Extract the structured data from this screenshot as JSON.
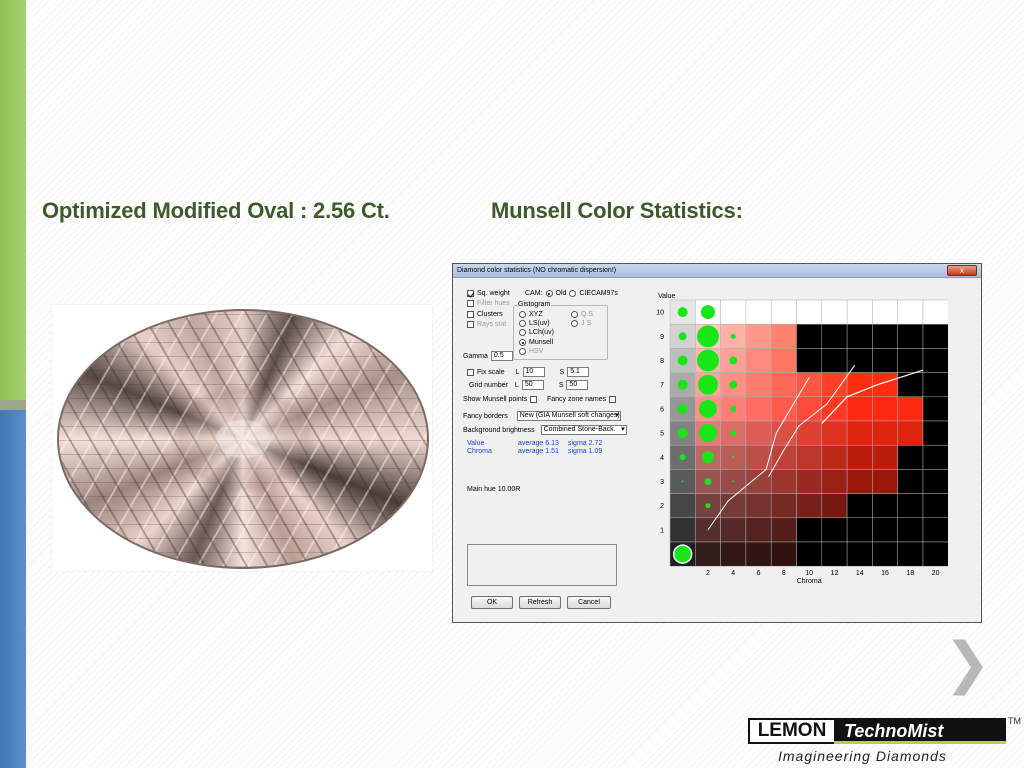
{
  "slide": {
    "title_left": "Optimized Modified Oval : 2.56 Ct.",
    "title_right": "Munsell Color Statistics:",
    "next_arrow": "❯",
    "colors": {
      "accent_green": "#8cc152",
      "accent_blue": "#3f78b8",
      "heading": "#3d5a2a"
    }
  },
  "dialog": {
    "title": "Diamond color statistics (NO chromatic dispersion!)",
    "close": "x",
    "sq_weight": "Sq. weight",
    "filter_hues": "Filter hues",
    "clusters": "Clusters",
    "rays_stat": "Rays stat",
    "cam_label": "CAM:",
    "cam_old": "Old",
    "cam_ciecam": "CIECAM97s",
    "gistogram": "Gistogram",
    "opt_xyz": "XYZ",
    "opt_ls": "LS(uv)",
    "opt_lch": "LCh(uv)",
    "opt_munsell": "Munsell",
    "opt_hsv": "HSV",
    "opt_qs": "Q S",
    "opt_js": "J S",
    "gamma_label": "Gamma",
    "gamma_value": "0.5",
    "fix_scale": "Fix scale",
    "l_label": "L",
    "s_label": "S",
    "fix_l": "10",
    "fix_s": "5.1",
    "grid_number": "Grid number",
    "grid_l": "50",
    "grid_s": "50",
    "show_munsell": "Show Munsell points",
    "fancy_zone": "Fancy zone names",
    "fancy_borders": "Fancy borders",
    "fancy_borders_value": "New (GIA Munsell soft changes)",
    "background_brightness": "Background brightness",
    "background_value": "Combined Stone-Back.",
    "stats": {
      "value_label": "Value",
      "value_avg": "average  6.13",
      "value_sigma": "sigma  2.72",
      "chroma_label": "Chroma",
      "chroma_avg": "average  1.51",
      "chroma_sigma": "sigma  1.09"
    },
    "main_hue": "Main hue 10.00R",
    "ok": "OK",
    "refresh": "Refresh",
    "cancel": "Cancel"
  },
  "chart_data": {
    "type": "heatmap",
    "title": "",
    "xlabel": "Chroma",
    "ylabel": "Value",
    "x_ticks": [
      2,
      4,
      6,
      8,
      10,
      12,
      14,
      16,
      18,
      20
    ],
    "y_ticks": [
      1,
      2,
      3,
      4,
      5,
      6,
      7,
      8,
      9,
      10
    ],
    "xlim": [
      0,
      20
    ],
    "ylim": [
      0,
      10
    ],
    "points": [
      {
        "x": 0,
        "y": 0,
        "size": 9
      },
      {
        "x": 0,
        "y": 3,
        "size": 1
      },
      {
        "x": 0,
        "y": 4,
        "size": 3
      },
      {
        "x": 0,
        "y": 5,
        "size": 5
      },
      {
        "x": 0,
        "y": 6,
        "size": 5
      },
      {
        "x": 0,
        "y": 7,
        "size": 5
      },
      {
        "x": 0,
        "y": 8,
        "size": 5
      },
      {
        "x": 0,
        "y": 9,
        "size": 4
      },
      {
        "x": 0,
        "y": 10,
        "size": 5
      },
      {
        "x": 2,
        "y": 1,
        "size": 0.6
      },
      {
        "x": 2,
        "y": 2,
        "size": 2.5
      },
      {
        "x": 2,
        "y": 3,
        "size": 3.5
      },
      {
        "x": 2,
        "y": 4,
        "size": 6
      },
      {
        "x": 2,
        "y": 5,
        "size": 9
      },
      {
        "x": 2,
        "y": 6,
        "size": 9
      },
      {
        "x": 2,
        "y": 7,
        "size": 10
      },
      {
        "x": 2,
        "y": 8,
        "size": 11
      },
      {
        "x": 2,
        "y": 9,
        "size": 11
      },
      {
        "x": 2,
        "y": 10,
        "size": 7
      },
      {
        "x": 4,
        "y": 3,
        "size": 1
      },
      {
        "x": 4,
        "y": 4,
        "size": 1.2
      },
      {
        "x": 4,
        "y": 5,
        "size": 3
      },
      {
        "x": 4,
        "y": 6,
        "size": 3
      },
      {
        "x": 4,
        "y": 7,
        "size": 4
      },
      {
        "x": 4,
        "y": 8,
        "size": 4
      },
      {
        "x": 4,
        "y": 9,
        "size": 2.5
      }
    ],
    "grid": true
  }
}
